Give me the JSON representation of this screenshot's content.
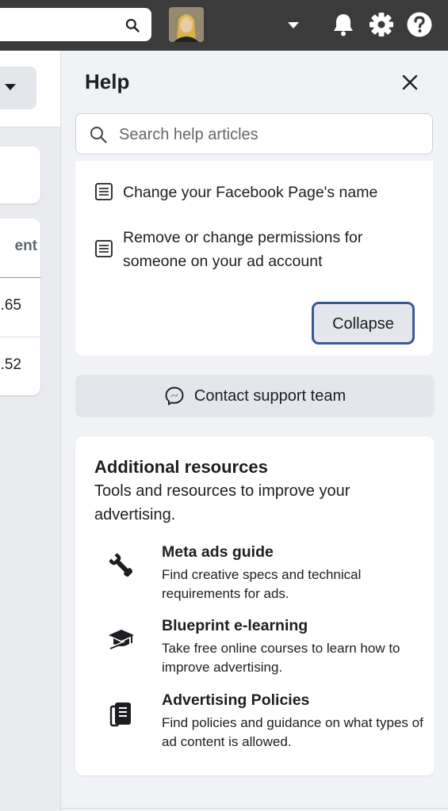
{
  "topbar": {
    "search_icon": "search-icon",
    "avatar_label": "user avatar",
    "icons": [
      "caret-down-icon",
      "bell-icon",
      "gear-icon",
      "help-icon"
    ]
  },
  "left": {
    "column_header": "ent",
    "rows": [
      ".65",
      ".52"
    ]
  },
  "help": {
    "title": "Help",
    "search_placeholder": "Search help articles",
    "articles": [
      "Change your Facebook Page's name",
      "Remove or change permissions for someone on your ad account"
    ],
    "collapse_label": "Collapse",
    "contact_label": "Contact support team"
  },
  "resources": {
    "title": "Additional resources",
    "subtitle": "Tools and resources to improve your advertising.",
    "items": [
      {
        "title": "Meta ads guide",
        "desc": "Find creative specs and technical requirements for ads.",
        "icon": "wrench-icon"
      },
      {
        "title": "Blueprint e-learning",
        "desc": "Take free online courses to learn how to improve advertising.",
        "icon": "graduation-cap-icon"
      },
      {
        "title": "Advertising Policies",
        "desc": "Find policies and guidance on what types of ad content is allowed.",
        "icon": "policy-book-icon"
      }
    ]
  },
  "colors": {
    "topbar": "#3b3b3b",
    "focus_border": "#385898",
    "button_bg": "#e4e6eb"
  }
}
